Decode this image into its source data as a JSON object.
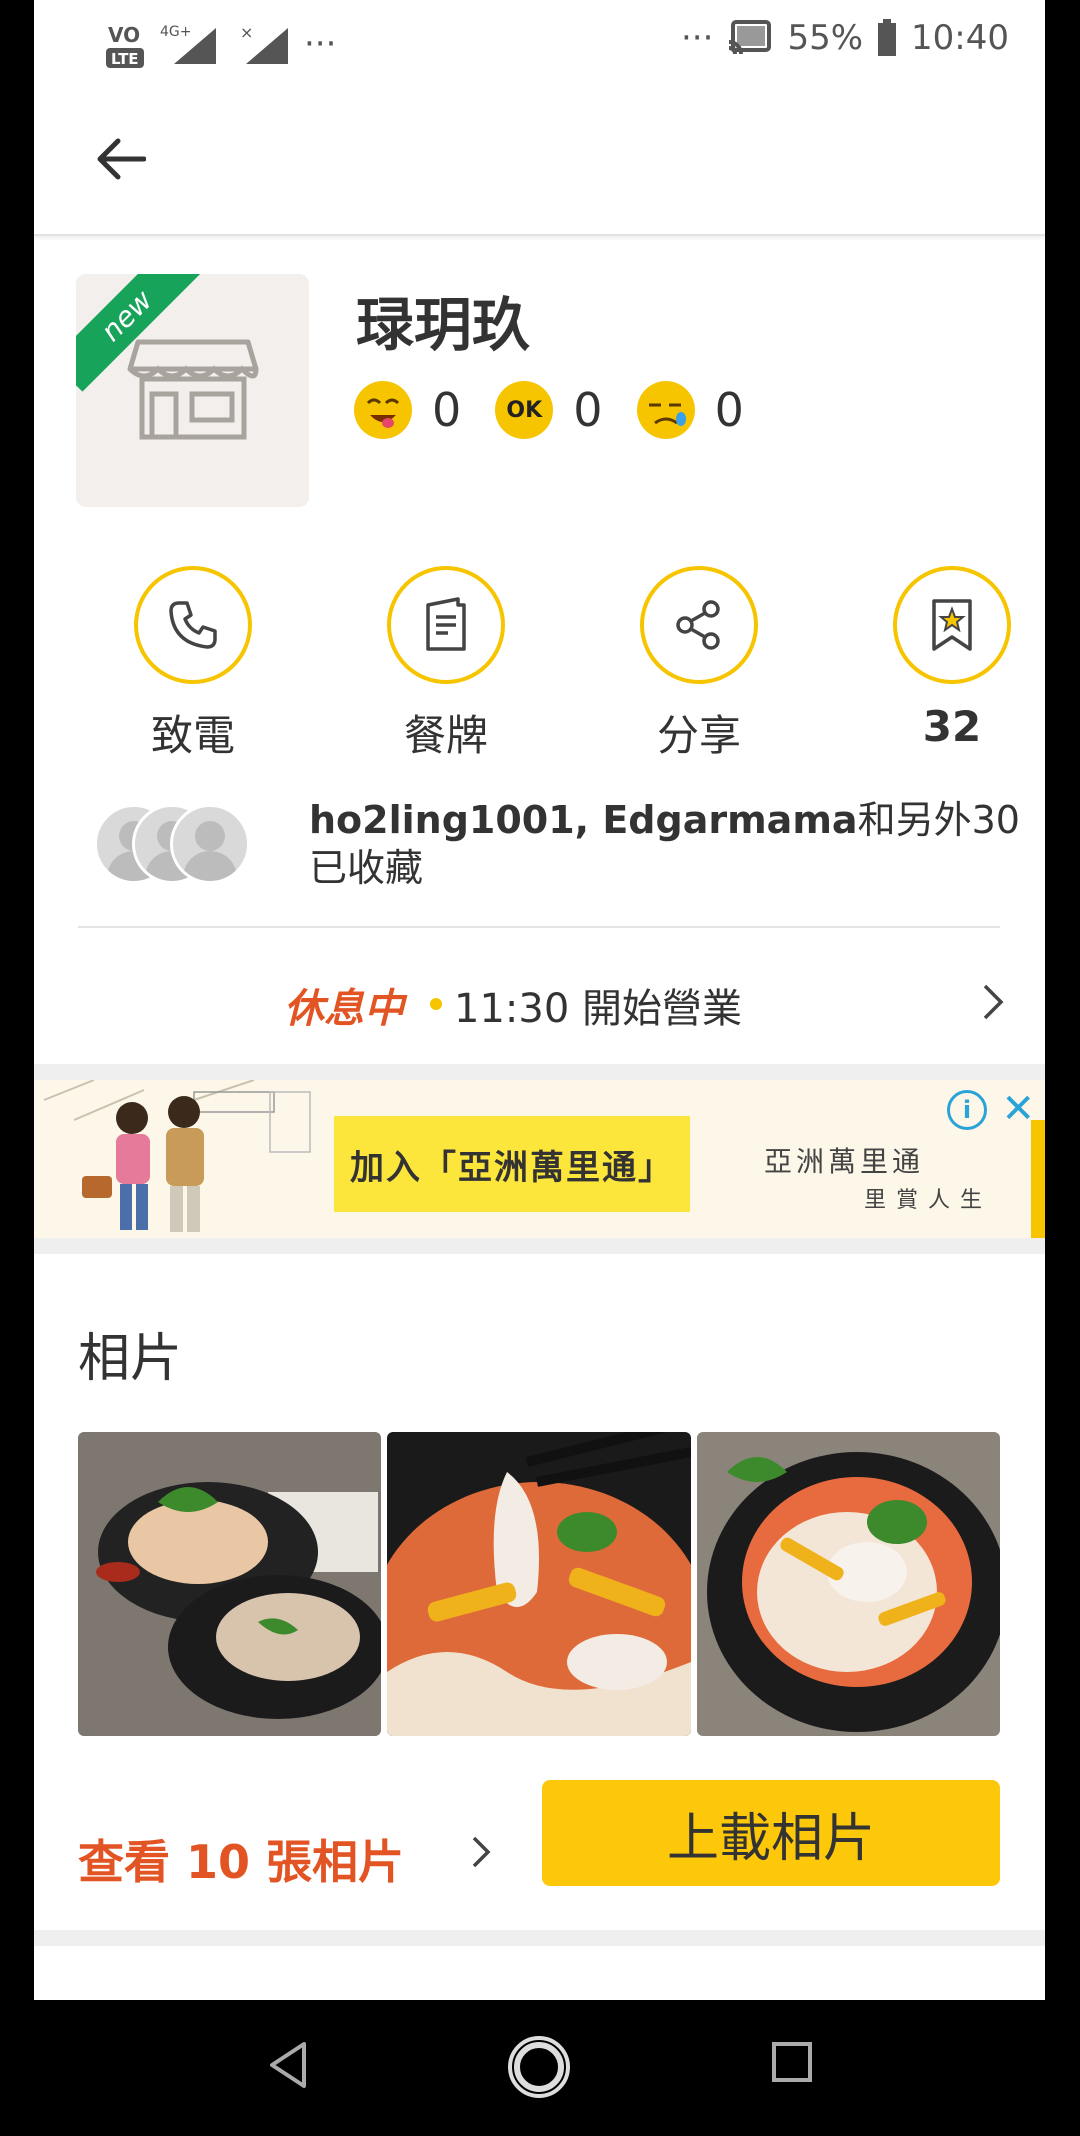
{
  "status_bar": {
    "left_icons": [
      "volte-icon",
      "signal-4g-icon",
      "signal-x-icon"
    ],
    "dots_left": "···",
    "dots_right": "···",
    "battery": "55%",
    "time": "10:40"
  },
  "store": {
    "badge": "new",
    "name": "琭玥玖",
    "ratings": [
      {
        "icon": "yummy-emoji-icon",
        "count": "0"
      },
      {
        "icon": "ok-emoji-icon",
        "count": "0"
      },
      {
        "icon": "sad-emoji-icon",
        "count": "0"
      }
    ]
  },
  "actions": {
    "call": "致電",
    "menu": "餐牌",
    "share": "分享",
    "bookmark_count": "32"
  },
  "collectors": {
    "names": "ho2ling1001, Edgarmama",
    "suffix": "和另外30已收藏"
  },
  "hours": {
    "status": "休息中",
    "next_open": "11:30 開始營業"
  },
  "ad": {
    "cta": "加入「亞洲萬里通」",
    "brand": "亞洲萬里通",
    "brand_tagline": "里賞人生",
    "info": "i",
    "close": "✕"
  },
  "photos": {
    "title": "相片",
    "view_more": "查看 10 張相片",
    "upload": "上載相片"
  },
  "colors": {
    "accent_yellow": "#F7C400",
    "accent_orange": "#E35424",
    "new_green": "#18A35A"
  }
}
